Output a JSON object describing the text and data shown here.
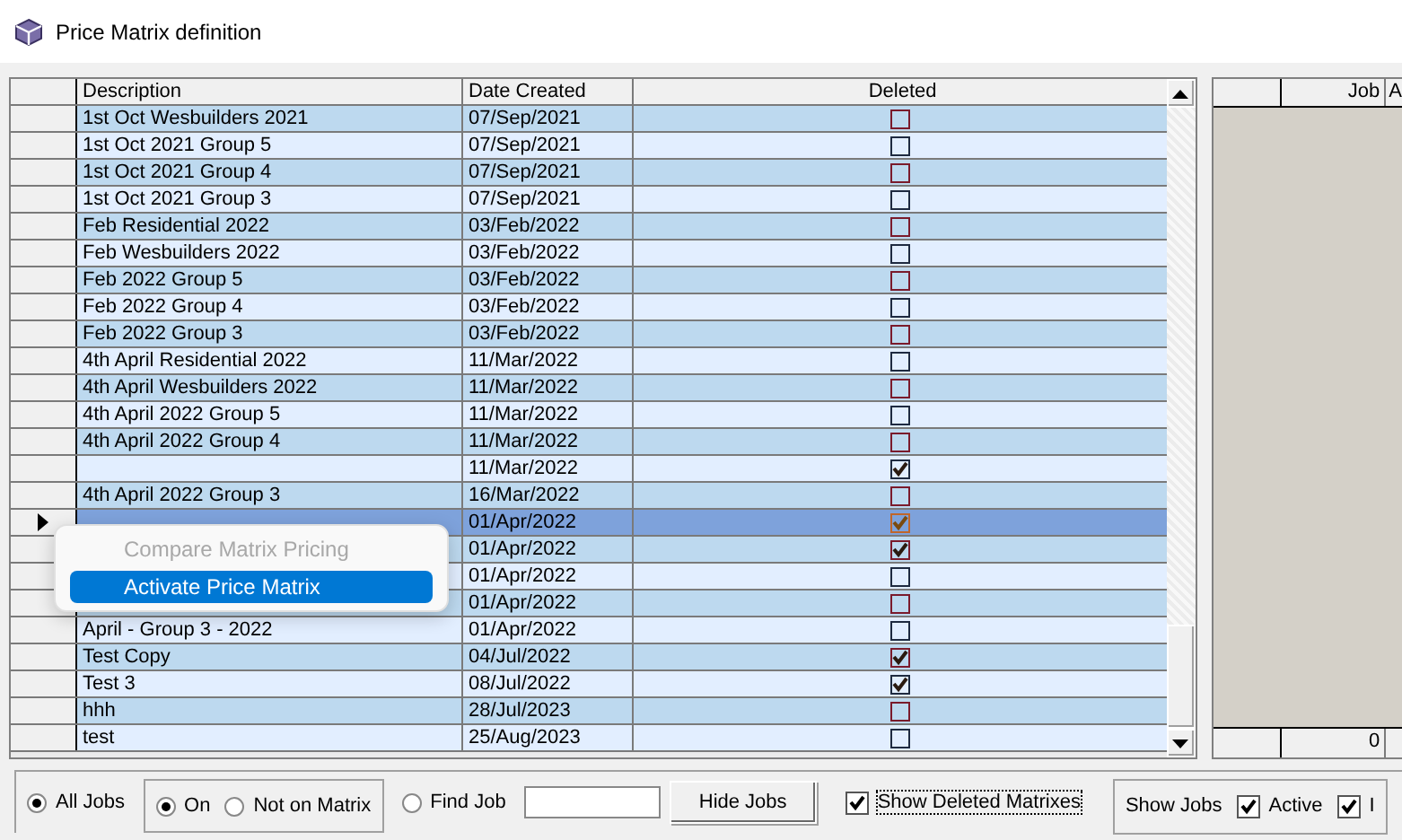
{
  "window": {
    "title": "Price Matrix definition"
  },
  "table": {
    "columns": [
      "Description",
      "Date Created",
      "Deleted"
    ],
    "rows": [
      {
        "description": "1st Oct Wesbuilders 2021",
        "date": "07/Sep/2021",
        "deleted": false,
        "selected": false
      },
      {
        "description": "1st Oct 2021 Group 5",
        "date": "07/Sep/2021",
        "deleted": false,
        "selected": false
      },
      {
        "description": "1st Oct 2021 Group 4",
        "date": "07/Sep/2021",
        "deleted": false,
        "selected": false
      },
      {
        "description": "1st Oct 2021 Group 3",
        "date": "07/Sep/2021",
        "deleted": false,
        "selected": false
      },
      {
        "description": "Feb Residential 2022",
        "date": "03/Feb/2022",
        "deleted": false,
        "selected": false
      },
      {
        "description": "Feb Wesbuilders 2022",
        "date": "03/Feb/2022",
        "deleted": false,
        "selected": false
      },
      {
        "description": "Feb 2022 Group 5",
        "date": "03/Feb/2022",
        "deleted": false,
        "selected": false
      },
      {
        "description": "Feb 2022 Group 4",
        "date": "03/Feb/2022",
        "deleted": false,
        "selected": false
      },
      {
        "description": "Feb 2022 Group 3",
        "date": "03/Feb/2022",
        "deleted": false,
        "selected": false
      },
      {
        "description": "4th April Residential 2022",
        "date": "11/Mar/2022",
        "deleted": false,
        "selected": false
      },
      {
        "description": "4th April Wesbuilders 2022",
        "date": "11/Mar/2022",
        "deleted": false,
        "selected": false
      },
      {
        "description": "4th April 2022 Group 5",
        "date": "11/Mar/2022",
        "deleted": false,
        "selected": false
      },
      {
        "description": "4th April 2022 Group 4",
        "date": "11/Mar/2022",
        "deleted": false,
        "selected": false
      },
      {
        "date": "11/Mar/2022",
        "deleted": true,
        "selected": false
      },
      {
        "description": "4th April 2022 Group 3",
        "date": "16/Mar/2022",
        "deleted": false,
        "selected": false
      },
      {
        "date": "01/Apr/2022",
        "deleted": true,
        "selected": true
      },
      {
        "date": "01/Apr/2022",
        "deleted": true,
        "selected": false
      },
      {
        "date": "01/Apr/2022",
        "deleted": false,
        "selected": false
      },
      {
        "date": "01/Apr/2022",
        "deleted": false,
        "selected": false
      },
      {
        "description": "April - Group 3 - 2022",
        "date": "01/Apr/2022",
        "deleted": false,
        "selected": false
      },
      {
        "description": "Test Copy",
        "date": "04/Jul/2022",
        "deleted": true,
        "selected": false
      },
      {
        "description": "Test 3",
        "date": "08/Jul/2022",
        "deleted": true,
        "selected": false
      },
      {
        "description": "hhh",
        "date": "28/Jul/2023",
        "deleted": false,
        "selected": false
      },
      {
        "description": "test",
        "date": "25/Aug/2023",
        "deleted": false,
        "selected": false
      }
    ]
  },
  "context_menu": {
    "items": [
      {
        "label": "Compare Matrix Pricing",
        "disabled": true,
        "selected": false
      },
      {
        "label": "Activate Price Matrix",
        "disabled": false,
        "selected": true
      }
    ]
  },
  "jobs_panel": {
    "columns": [
      "Job",
      "A"
    ],
    "footer": "0"
  },
  "toolbar": {
    "job_filter": [
      {
        "label": "All Jobs",
        "selected": true
      }
    ],
    "matrix_filter": [
      {
        "label": "On",
        "selected": true
      },
      {
        "label": "Not on Matrix",
        "selected": false
      }
    ],
    "find_job": {
      "label": "Find Job",
      "selected": false
    },
    "hide_button": "Hide Jobs",
    "show_deleted": {
      "label": "Show Deleted Matrixes",
      "checked": true
    },
    "show_jobs": {
      "label": "Show Jobs",
      "options": [
        {
          "label": "Active",
          "checked": true
        },
        {
          "label": "I",
          "checked": true
        }
      ]
    }
  }
}
